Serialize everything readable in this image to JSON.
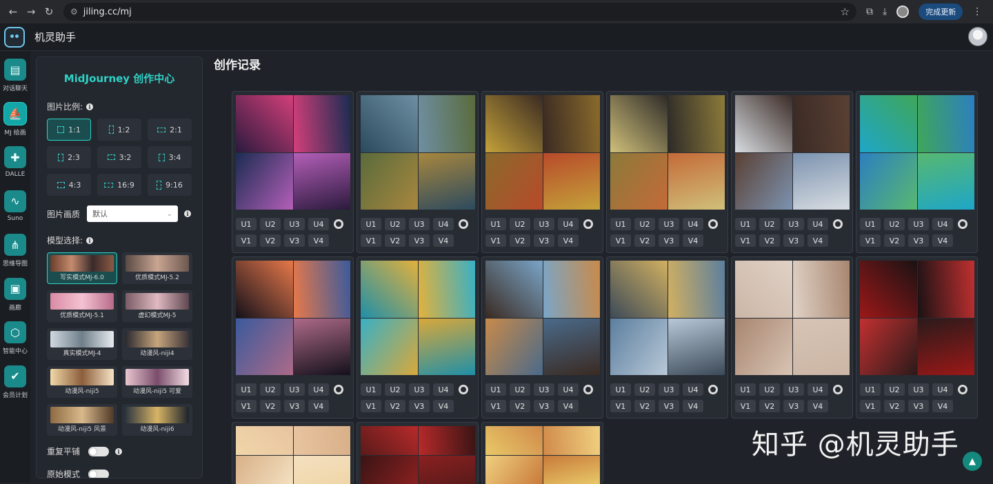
{
  "browser": {
    "back": "←",
    "forward": "→",
    "reload": "↻",
    "url": "jiling.cc/mj",
    "update_label": "完成更新"
  },
  "app": {
    "title": "机灵助手"
  },
  "rail": [
    {
      "label": "对话聊天",
      "icon": "chat-icon",
      "glyph": "▤"
    },
    {
      "label": "MJ 绘画",
      "icon": "sailboat-icon",
      "glyph": "⛵"
    },
    {
      "label": "DALLE",
      "icon": "image-plus-icon",
      "glyph": "✚"
    },
    {
      "label": "Suno",
      "icon": "music-wave-icon",
      "glyph": "∿"
    },
    {
      "label": "思维导图",
      "icon": "mindmap-icon",
      "glyph": "⋔"
    },
    {
      "label": "画廊",
      "icon": "gallery-icon",
      "glyph": "▣"
    },
    {
      "label": "智能中心",
      "icon": "cube-icon",
      "glyph": "⬡"
    },
    {
      "label": "会员计划",
      "icon": "member-icon",
      "glyph": "✔"
    }
  ],
  "settings": {
    "title": "MidJourney 创作中心",
    "ratio_label": "图片比例:",
    "ratios": [
      "1:1",
      "1:2",
      "2:1",
      "2:3",
      "3:2",
      "3:4",
      "4:3",
      "16:9",
      "9:16"
    ],
    "quality_label": "图片画质",
    "quality_value": "默认",
    "model_label": "模型选择:",
    "models": [
      "写实模式MJ-6.0",
      "优质模式MJ-5.2",
      "优质模式MJ-5.1",
      "虚幻模式MJ-5",
      "真实模式MJ-4",
      "动漫风-niji4",
      "动漫风-niji5",
      "动漫风-niji5 可爱",
      "动漫风-niji5 风景",
      "动漫风-niji6"
    ],
    "tile_label": "重复平铺",
    "raw_label": "原始模式"
  },
  "main": {
    "title": "创作记录",
    "upscale_buttons": [
      "U1",
      "U2",
      "U3",
      "U4"
    ],
    "variation_buttons": [
      "V1",
      "V2",
      "V3",
      "V4"
    ]
  },
  "watermark": "知乎 @机灵助手"
}
